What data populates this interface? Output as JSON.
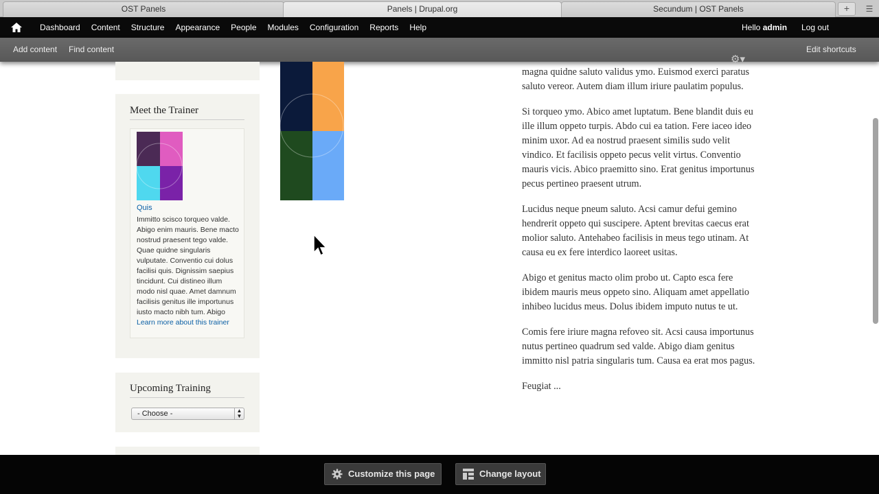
{
  "browser": {
    "tabs": [
      {
        "title": "OST Panels"
      },
      {
        "title": "Panels | Drupal.org"
      },
      {
        "title": "Secundum | OST Panels"
      }
    ],
    "new_tab": "+"
  },
  "toolbar": {
    "items": [
      "Dashboard",
      "Content",
      "Structure",
      "Appearance",
      "People",
      "Modules",
      "Configuration",
      "Reports",
      "Help"
    ],
    "hello": "Hello ",
    "username": "admin",
    "logout": "Log out"
  },
  "shortcuts": {
    "add_content": "Add content",
    "find_content": "Find content",
    "edit_shortcuts": "Edit shortcuts"
  },
  "sidebar": {
    "trainer": {
      "title": "Meet the Trainer",
      "name": "Quis",
      "bio": "Immitto scisco torqueo valde. Abigo enim mauris. Bene macto nostrud praesent tego valde. Quae quidne singularis vulputate. Conventio cui dolus facilisi quis. Dignissim saepius tincidunt. Cui distineo illum modo nisl quae. Amet damnum facilisis genitus ille importunus iusto macto nibh tum. Abigo ",
      "link": "Learn more about this trainer"
    },
    "upcoming": {
      "title": "Upcoming Training",
      "select_value": "- Choose -"
    }
  },
  "main": {
    "paragraphs": [
      "magna quidne saluto validus ymo. Euismod exerci paratus saluto vereor. Autem diam illum iriure paulatim populus.",
      "Si torqueo ymo. Abico amet luptatum. Bene blandit duis eu ille illum oppeto turpis. Abdo cui ea tation. Fere iaceo ideo minim uxor. Ad ea nostrud praesent similis sudo velit vindico. Et facilisis oppeto pecus velit virtus. Conventio mauris vicis. Abico praemitto sino. Erat genitus importunus pecus pertineo praesent utrum.",
      "Lucidus neque pneum saluto. Acsi camur defui gemino hendrerit oppeto qui suscipere. Aptent brevitas caecus erat molior saluto. Antehabeo facilisis in meus tego utinam. At causa eu ex fere interdico laoreet usitas.",
      "Abigo et genitus macto olim probo ut. Capto esca fere ibidem mauris meus oppeto sino. Aliquam amet appellatio inhibeo lucidus meus. Dolus ibidem imputo nutus te ut.",
      "Comis fere iriure magna refoveo sit. Acsi causa importunus nutus pertineo quadrum sed valde. Abigo diam genitus immitto nisl patria singularis tum. Causa ea erat mos pagus.",
      "Feugiat ..."
    ]
  },
  "panels_bar": {
    "customize": "Customize this page",
    "change_layout": "Change layout"
  },
  "colors": {
    "toolbar_bg": "#0a0a0a",
    "shortcut_bg": "#5f5f5f",
    "link": "#0a5fa5",
    "sidebar_bg": "#f3f3ee",
    "trainer_img": [
      "#4b2a55",
      "#e05cc0",
      "#4fd8ef",
      "#7a22a8"
    ],
    "photo": [
      "#0b1a3a",
      "#f8a44a",
      "#1f4a1f",
      "#6aaaf8"
    ]
  },
  "icons": [
    "home-icon",
    "gear-icon",
    "chevron-down-icon",
    "cursor-icon",
    "layout-icon"
  ]
}
